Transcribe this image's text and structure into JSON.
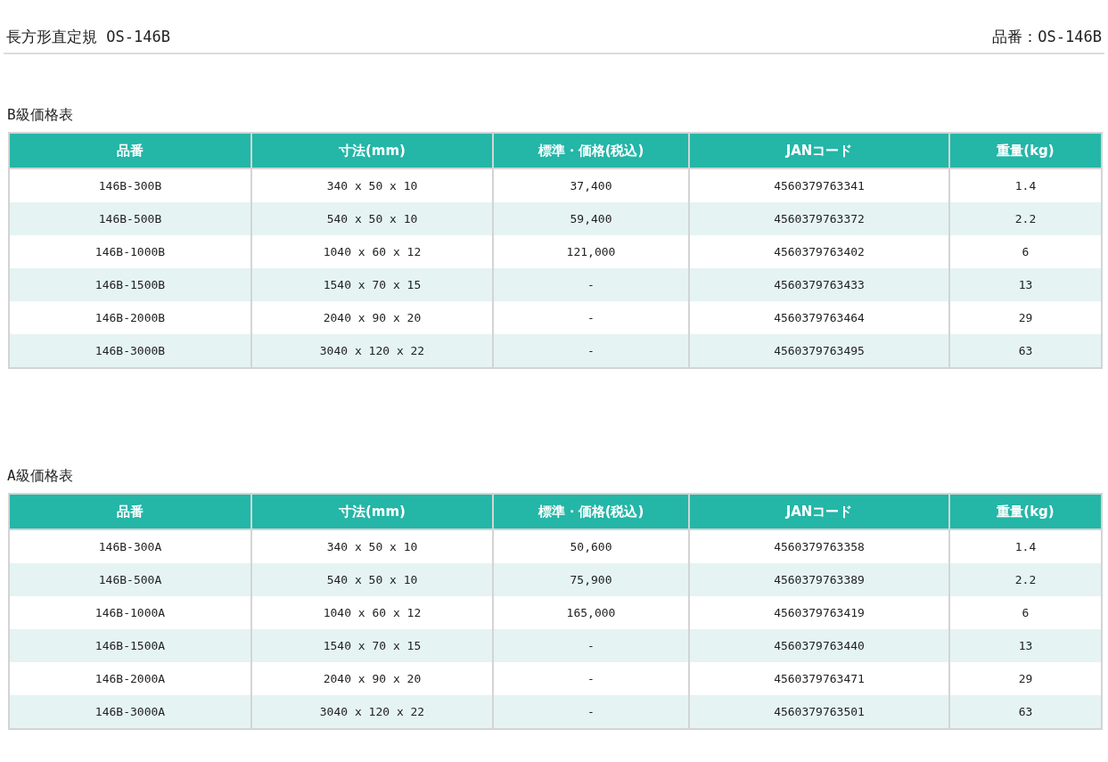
{
  "header": {
    "title": "長方形直定規 OS-146B",
    "product_code": "品番：OS-146B"
  },
  "sections": [
    {
      "title": "B級価格表",
      "columns": [
        "品番",
        "寸法(mm)",
        "標準・価格(税込)",
        "JANコード",
        "重量(kg)"
      ],
      "rows": [
        [
          "146B-300B",
          "340 x 50 x 10",
          "37,400",
          "4560379763341",
          "1.4"
        ],
        [
          "146B-500B",
          "540 x 50 x 10",
          "59,400",
          "4560379763372",
          "2.2"
        ],
        [
          "146B-1000B",
          "1040 x 60 x 12",
          "121,000",
          "4560379763402",
          "6"
        ],
        [
          "146B-1500B",
          "1540 x 70 x 15",
          "-",
          "4560379763433",
          "13"
        ],
        [
          "146B-2000B",
          "2040 x 90 x 20",
          "-",
          "4560379763464",
          "29"
        ],
        [
          "146B-3000B",
          "3040 x 120 x 22",
          "-",
          "4560379763495",
          "63"
        ]
      ]
    },
    {
      "title": "A級価格表",
      "columns": [
        "品番",
        "寸法(mm)",
        "標準・価格(税込)",
        "JANコード",
        "重量(kg)"
      ],
      "rows": [
        [
          "146B-300A",
          "340 x 50 x 10",
          "50,600",
          "4560379763358",
          "1.4"
        ],
        [
          "146B-500A",
          "540 x 50 x 10",
          "75,900",
          "4560379763389",
          "2.2"
        ],
        [
          "146B-1000A",
          "1040 x 60 x 12",
          "165,000",
          "4560379763419",
          "6"
        ],
        [
          "146B-1500A",
          "1540 x 70 x 15",
          "-",
          "4560379763440",
          "13"
        ],
        [
          "146B-2000A",
          "2040 x 90 x 20",
          "-",
          "4560379763471",
          "29"
        ],
        [
          "146B-3000A",
          "3040 x 120 x 22",
          "-",
          "4560379763501",
          "63"
        ]
      ]
    }
  ]
}
